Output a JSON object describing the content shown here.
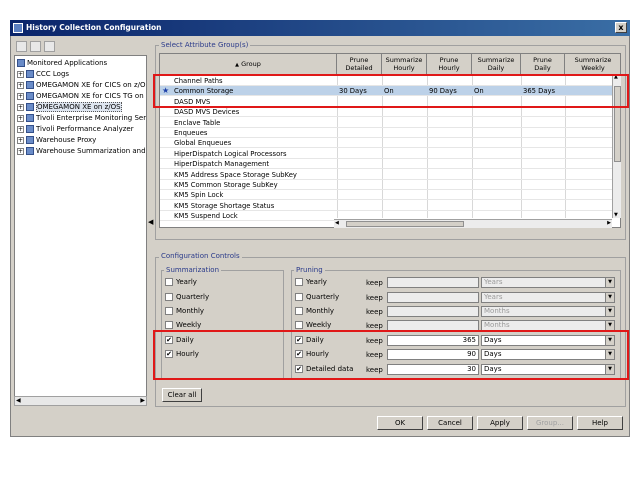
{
  "window": {
    "title": "History Collection Configuration",
    "close_glyph": "x"
  },
  "tree": {
    "items": [
      {
        "label": "Monitored Applications",
        "expander": "",
        "depth": 0
      },
      {
        "label": "CCC Logs",
        "expander": "+",
        "depth": 1
      },
      {
        "label": "OMEGAMON XE for CICS on z/OS",
        "expander": "+",
        "depth": 1
      },
      {
        "label": "OMEGAMON XE for CICS TG on z",
        "expander": "+",
        "depth": 1
      },
      {
        "label": "OMEGAMON XE on z/OS",
        "expander": "+",
        "depth": 1,
        "selected": true
      },
      {
        "label": "Tivoli Enterprise Monitoring Serv",
        "expander": "+",
        "depth": 1
      },
      {
        "label": "Tivoli Performance Analyzer",
        "expander": "+",
        "depth": 1
      },
      {
        "label": "Warehouse Proxy",
        "expander": "+",
        "depth": 1
      },
      {
        "label": "Warehouse Summarization and",
        "expander": "+",
        "depth": 1
      }
    ]
  },
  "attributes": {
    "title": "Select Attribute Group(s)",
    "columns": {
      "group": "Group",
      "group_sort": "▲",
      "prune_detailed": [
        "Prune",
        "Detailed"
      ],
      "sum_hourly": [
        "Summarize",
        "Hourly"
      ],
      "prune_hourly": [
        "Prune",
        "Hourly"
      ],
      "sum_daily": [
        "Summarize",
        "Daily"
      ],
      "prune_daily": [
        "Prune",
        "Daily"
      ],
      "sum_weekly": [
        "Summarize",
        "Weekly"
      ]
    },
    "rows": [
      {
        "group": "Channel Paths",
        "pd": "",
        "sh": "",
        "ph": "",
        "sd": "",
        "pdy": "",
        "sw": ""
      },
      {
        "group": "Common Storage",
        "pd": "30 Days",
        "sh": "On",
        "ph": "90 Days",
        "sd": "On",
        "pdy": "365 Days",
        "sw": "",
        "selected": true
      },
      {
        "group": "DASD MVS",
        "pd": "",
        "sh": "",
        "ph": "",
        "sd": "",
        "pdy": "",
        "sw": ""
      },
      {
        "group": "DASD MVS Devices",
        "pd": "",
        "sh": "",
        "ph": "",
        "sd": "",
        "pdy": "",
        "sw": ""
      },
      {
        "group": "Enclave Table",
        "pd": "",
        "sh": "",
        "ph": "",
        "sd": "",
        "pdy": "",
        "sw": ""
      },
      {
        "group": "Enqueues",
        "pd": "",
        "sh": "",
        "ph": "",
        "sd": "",
        "pdy": "",
        "sw": ""
      },
      {
        "group": "Global Enqueues",
        "pd": "",
        "sh": "",
        "ph": "",
        "sd": "",
        "pdy": "",
        "sw": ""
      },
      {
        "group": "HiperDispatch Logical Processors",
        "pd": "",
        "sh": "",
        "ph": "",
        "sd": "",
        "pdy": "",
        "sw": ""
      },
      {
        "group": "HiperDispatch Management",
        "pd": "",
        "sh": "",
        "ph": "",
        "sd": "",
        "pdy": "",
        "sw": ""
      },
      {
        "group": "KM5 Address Space Storage SubKey",
        "pd": "",
        "sh": "",
        "ph": "",
        "sd": "",
        "pdy": "",
        "sw": ""
      },
      {
        "group": "KM5 Common Storage SubKey",
        "pd": "",
        "sh": "",
        "ph": "",
        "sd": "",
        "pdy": "",
        "sw": ""
      },
      {
        "group": "KM5 Spin Lock",
        "pd": "",
        "sh": "",
        "ph": "",
        "sd": "",
        "pdy": "",
        "sw": ""
      },
      {
        "group": "KM5 Storage Shortage Status",
        "pd": "",
        "sh": "",
        "ph": "",
        "sd": "",
        "pdy": "",
        "sw": ""
      },
      {
        "group": "KM5 Suspend Lock",
        "pd": "",
        "sh": "",
        "ph": "",
        "sd": "",
        "pdy": "",
        "sw": ""
      }
    ]
  },
  "config": {
    "title": "Configuration Controls",
    "summarization": {
      "title": "Summarization",
      "items": [
        {
          "label": "Yearly",
          "checked": false
        },
        {
          "label": "Quarterly",
          "checked": false
        },
        {
          "label": "Monthly",
          "checked": false
        },
        {
          "label": "Weekly",
          "checked": false
        },
        {
          "label": "Daily",
          "checked": true
        },
        {
          "label": "Hourly",
          "checked": true
        }
      ]
    },
    "pruning": {
      "title": "Pruning",
      "keep_label": "keep",
      "items": [
        {
          "label": "Yearly",
          "checked": false,
          "value": "",
          "unit": "Years",
          "enabled": false
        },
        {
          "label": "Quarterly",
          "checked": false,
          "value": "",
          "unit": "Years",
          "enabled": false
        },
        {
          "label": "Monthly",
          "checked": false,
          "value": "",
          "unit": "Months",
          "enabled": false
        },
        {
          "label": "Weekly",
          "checked": false,
          "value": "",
          "unit": "Months",
          "enabled": false
        },
        {
          "label": "Daily",
          "checked": true,
          "value": "365",
          "unit": "Days",
          "enabled": true
        },
        {
          "label": "Hourly",
          "checked": true,
          "value": "90",
          "unit": "Days",
          "enabled": true
        },
        {
          "label": "Detailed data",
          "checked": true,
          "value": "30",
          "unit": "Days",
          "enabled": true
        }
      ]
    },
    "clear_all": "Clear all"
  },
  "buttons": {
    "ok": "OK",
    "cancel": "Cancel",
    "apply": "Apply",
    "group": "Group...",
    "help": "Help"
  },
  "colors": {
    "highlight": "#e01818",
    "selection": "#bcd1e8",
    "title_bar": "#0a246a"
  }
}
